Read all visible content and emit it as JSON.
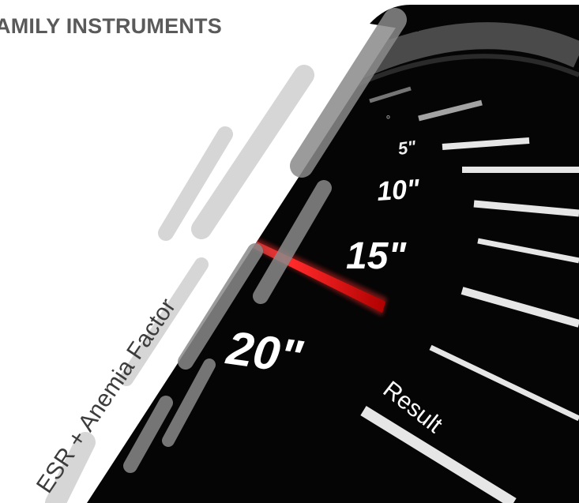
{
  "header": {
    "title": "AMILY INSTRUMENTS"
  },
  "caption": {
    "text": "ESR + Anemia Factor"
  },
  "gauge": {
    "labels": [
      "5\"",
      "10\"",
      "15\"",
      "20\""
    ],
    "result_label": "Result",
    "colors": {
      "needle": "#e01e1e",
      "background": "#000000",
      "ticks": "#f2f2f2"
    }
  }
}
